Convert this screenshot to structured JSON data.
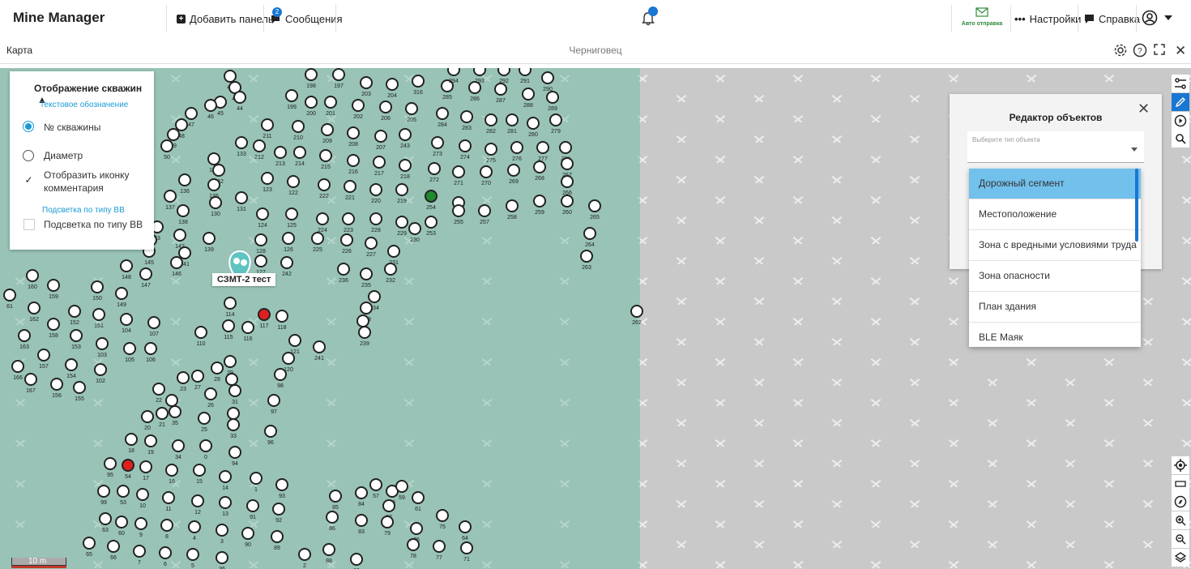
{
  "topbar": {
    "title": "Mine Manager",
    "add_panel": "Добавить панель",
    "messages": "Сообщения",
    "messages_badge": "2",
    "auto_send": "Авто отправка",
    "settings": "Настройки",
    "help": "Справка"
  },
  "map_header": {
    "label": "Карта",
    "name": "Черниговец"
  },
  "well_panel": {
    "title": "Отображение скважин",
    "text_label": "Текстовое обозначение",
    "opt_number": "№ скважины",
    "opt_diameter": "Диаметр",
    "show_comment_icon": "Отобразить иконку комментария",
    "bb_label": "Подсветка по типу ВВ",
    "bb_option": "Подсветка по типу ВВ"
  },
  "editor": {
    "title": "Редактор объектов",
    "placeholder": "Выберите тип объекта",
    "options": [
      "Дорожный сегмент",
      "Местоположение",
      "Зона с вредными условиями труда",
      "Зона опасности",
      "План здания",
      "BLE Маяк"
    ]
  },
  "marker": {
    "label": "СЗМТ-2 тест"
  },
  "scale": {
    "label": "10 m"
  },
  "colors": {
    "map_green": "#98c3b6",
    "map_gray": "#c9c9c9",
    "accent": "#1976d2"
  },
  "wells": [
    {
      "n": "42"
    },
    {
      "n": "43"
    },
    {
      "n": "44"
    },
    {
      "n": "45"
    },
    {
      "n": "46"
    },
    {
      "n": "47"
    },
    {
      "n": "48"
    },
    {
      "n": "49"
    },
    {
      "n": "50"
    },
    {
      "n": "198"
    },
    {
      "n": "197"
    },
    {
      "n": "203"
    },
    {
      "n": "204"
    },
    {
      "n": "316"
    },
    {
      "n": "285"
    },
    {
      "n": "286"
    },
    {
      "n": "287"
    },
    {
      "n": "288"
    },
    {
      "n": "290"
    },
    {
      "n": "294"
    },
    {
      "n": "293"
    },
    {
      "n": "292"
    },
    {
      "n": "291"
    },
    {
      "n": "289"
    },
    {
      "n": "199"
    },
    {
      "n": "200"
    },
    {
      "n": "201"
    },
    {
      "n": "202"
    },
    {
      "n": "206"
    },
    {
      "n": "205"
    },
    {
      "n": "284"
    },
    {
      "n": "283"
    },
    {
      "n": "282"
    },
    {
      "n": "281"
    },
    {
      "n": "280"
    },
    {
      "n": "279"
    },
    {
      "n": "211"
    },
    {
      "n": "210"
    },
    {
      "n": "209"
    },
    {
      "n": "208"
    },
    {
      "n": "207"
    },
    {
      "n": "243"
    },
    {
      "n": "273"
    },
    {
      "n": "274"
    },
    {
      "n": "275"
    },
    {
      "n": "276"
    },
    {
      "n": "277"
    },
    {
      "n": "278"
    },
    {
      "n": "133"
    },
    {
      "n": "212"
    },
    {
      "n": "213"
    },
    {
      "n": "214"
    },
    {
      "n": "215"
    },
    {
      "n": "216"
    },
    {
      "n": "217"
    },
    {
      "n": "218"
    },
    {
      "n": "272"
    },
    {
      "n": "271"
    },
    {
      "n": "270"
    },
    {
      "n": "269"
    },
    {
      "n": "268"
    },
    {
      "n": "267"
    },
    {
      "n": "266"
    },
    {
      "n": "134"
    },
    {
      "n": "132"
    },
    {
      "n": "135"
    },
    {
      "n": "136"
    },
    {
      "n": "123"
    },
    {
      "n": "122"
    },
    {
      "n": "222"
    },
    {
      "n": "221"
    },
    {
      "n": "220"
    },
    {
      "n": "219"
    },
    {
      "n": "254"
    },
    {
      "n": "256"
    },
    {
      "n": "255"
    },
    {
      "n": "257"
    },
    {
      "n": "258"
    },
    {
      "n": "259"
    },
    {
      "n": "260"
    },
    {
      "n": "265"
    },
    {
      "n": "137"
    },
    {
      "n": "131"
    },
    {
      "n": "130"
    },
    {
      "n": "124"
    },
    {
      "n": "125"
    },
    {
      "n": "224"
    },
    {
      "n": "223"
    },
    {
      "n": "228"
    },
    {
      "n": "229"
    },
    {
      "n": "253"
    },
    {
      "n": "230"
    },
    {
      "n": "264"
    },
    {
      "n": "138"
    },
    {
      "n": "43"
    },
    {
      "n": "142"
    },
    {
      "n": "139"
    },
    {
      "n": "128"
    },
    {
      "n": "126"
    },
    {
      "n": "225"
    },
    {
      "n": "226"
    },
    {
      "n": "227"
    },
    {
      "n": "231"
    },
    {
      "n": "144"
    },
    {
      "n": "145"
    },
    {
      "n": "141"
    },
    {
      "n": "146"
    },
    {
      "n": "127"
    },
    {
      "n": "242"
    },
    {
      "n": "236"
    },
    {
      "n": "235"
    },
    {
      "n": "232"
    },
    {
      "n": "263"
    },
    {
      "n": "148"
    },
    {
      "n": "147"
    },
    {
      "n": "160"
    },
    {
      "n": "159"
    },
    {
      "n": "150"
    },
    {
      "n": "149"
    },
    {
      "n": "234"
    },
    {
      "n": "233"
    },
    {
      "n": "61"
    },
    {
      "n": "162"
    },
    {
      "n": "152"
    },
    {
      "n": "151"
    },
    {
      "n": "104"
    },
    {
      "n": "107"
    },
    {
      "n": "114"
    },
    {
      "n": "117"
    },
    {
      "n": "118"
    },
    {
      "n": "238"
    },
    {
      "n": "239"
    },
    {
      "n": "262"
    },
    {
      "n": "158"
    },
    {
      "n": "163"
    },
    {
      "n": "153"
    },
    {
      "n": "103"
    },
    {
      "n": "110"
    },
    {
      "n": "115"
    },
    {
      "n": "116"
    },
    {
      "n": "105"
    },
    {
      "n": "106"
    },
    {
      "n": "121"
    },
    {
      "n": "241"
    },
    {
      "n": "157"
    },
    {
      "n": "166"
    },
    {
      "n": "154"
    },
    {
      "n": "102"
    },
    {
      "n": "120"
    },
    {
      "n": "29"
    },
    {
      "n": "28"
    },
    {
      "n": "27"
    },
    {
      "n": "98"
    },
    {
      "n": "167"
    },
    {
      "n": "156"
    },
    {
      "n": "155"
    },
    {
      "n": "23"
    },
    {
      "n": "30"
    },
    {
      "n": "31"
    },
    {
      "n": "26"
    },
    {
      "n": "24"
    },
    {
      "n": "22"
    },
    {
      "n": "97"
    },
    {
      "n": "32"
    },
    {
      "n": "20"
    },
    {
      "n": "21"
    },
    {
      "n": "35"
    },
    {
      "n": "25"
    },
    {
      "n": "33"
    },
    {
      "n": "96"
    },
    {
      "n": "18"
    },
    {
      "n": "19"
    },
    {
      "n": "34"
    },
    {
      "n": "0"
    },
    {
      "n": "94"
    },
    {
      "n": "95"
    },
    {
      "n": "54"
    },
    {
      "n": "17"
    },
    {
      "n": "16"
    },
    {
      "n": "15"
    },
    {
      "n": "14"
    },
    {
      "n": "1"
    },
    {
      "n": "93"
    },
    {
      "n": "99"
    },
    {
      "n": "53"
    },
    {
      "n": "10"
    },
    {
      "n": "11"
    },
    {
      "n": "12"
    },
    {
      "n": "13"
    },
    {
      "n": "91"
    },
    {
      "n": "92"
    },
    {
      "n": "85"
    },
    {
      "n": "84"
    },
    {
      "n": "57"
    },
    {
      "n": "58"
    },
    {
      "n": "59"
    },
    {
      "n": "61"
    },
    {
      "n": "62"
    },
    {
      "n": "63"
    },
    {
      "n": "60"
    },
    {
      "n": "9"
    },
    {
      "n": "8"
    },
    {
      "n": "4"
    },
    {
      "n": "3"
    },
    {
      "n": "90"
    },
    {
      "n": "89"
    },
    {
      "n": "86"
    },
    {
      "n": "83"
    },
    {
      "n": "79"
    },
    {
      "n": "76"
    },
    {
      "n": "75"
    },
    {
      "n": "64"
    },
    {
      "n": "65"
    },
    {
      "n": "66"
    },
    {
      "n": "7"
    },
    {
      "n": "6"
    },
    {
      "n": "5"
    },
    {
      "n": "36"
    },
    {
      "n": "2"
    },
    {
      "n": "88"
    },
    {
      "n": "80"
    },
    {
      "n": "78"
    },
    {
      "n": "77"
    },
    {
      "n": "71"
    },
    {
      "n": "70"
    },
    {
      "n": "67"
    }
  ]
}
